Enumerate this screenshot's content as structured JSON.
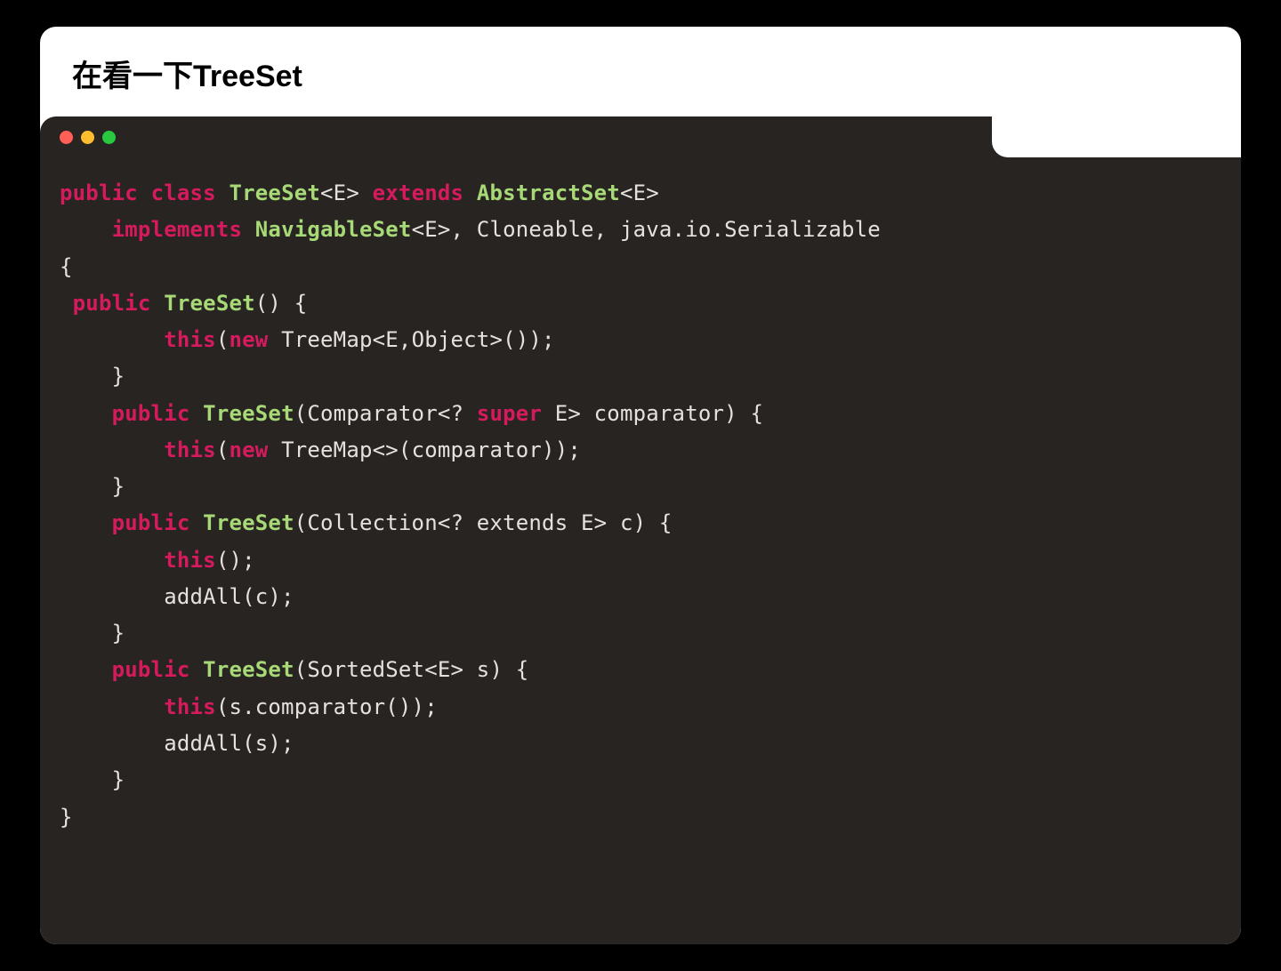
{
  "heading": "在看一下TreeSet",
  "colors": {
    "keyword": "#d61a5e",
    "name": "#a8d977",
    "text": "#e6e1dc",
    "codeBg": "#282422",
    "cardBg": "#ffffff",
    "pageBg": "#000000",
    "dotRed": "#ff5f57",
    "dotYellow": "#febc2e",
    "dotGreen": "#28c840"
  },
  "code": {
    "lines": [
      [
        {
          "cls": "kw-pub",
          "t": "public"
        },
        {
          "cls": "plain",
          "t": " "
        },
        {
          "cls": "kw-cls",
          "t": "class"
        },
        {
          "cls": "plain",
          "t": " "
        },
        {
          "cls": "name",
          "t": "TreeSet"
        },
        {
          "cls": "plain",
          "t": "<E> "
        },
        {
          "cls": "kw-ext",
          "t": "extends"
        },
        {
          "cls": "plain",
          "t": " "
        },
        {
          "cls": "name",
          "t": "AbstractSet"
        },
        {
          "cls": "plain",
          "t": "<E>"
        }
      ],
      [
        {
          "cls": "plain",
          "t": "    "
        },
        {
          "cls": "kw-impl",
          "t": "implements"
        },
        {
          "cls": "plain",
          "t": " "
        },
        {
          "cls": "name",
          "t": "NavigableSet"
        },
        {
          "cls": "plain",
          "t": "<E>, Cloneable, java.io.Serializable"
        }
      ],
      [
        {
          "cls": "plain",
          "t": "{"
        }
      ],
      [
        {
          "cls": "plain",
          "t": " "
        },
        {
          "cls": "kw-pub",
          "t": "public"
        },
        {
          "cls": "plain",
          "t": " "
        },
        {
          "cls": "name",
          "t": "TreeSet"
        },
        {
          "cls": "plain",
          "t": "() {"
        }
      ],
      [
        {
          "cls": "plain",
          "t": "        "
        },
        {
          "cls": "kw-this",
          "t": "this"
        },
        {
          "cls": "plain",
          "t": "("
        },
        {
          "cls": "kw-new",
          "t": "new"
        },
        {
          "cls": "plain",
          "t": " TreeMap<E,Object>());"
        }
      ],
      [
        {
          "cls": "plain",
          "t": "    }"
        }
      ],
      [
        {
          "cls": "plain",
          "t": "    "
        },
        {
          "cls": "kw-pub",
          "t": "public"
        },
        {
          "cls": "plain",
          "t": " "
        },
        {
          "cls": "name",
          "t": "TreeSet"
        },
        {
          "cls": "plain",
          "t": "(Comparator<? "
        },
        {
          "cls": "kw-super",
          "t": "super"
        },
        {
          "cls": "plain",
          "t": " E> comparator) {"
        }
      ],
      [
        {
          "cls": "plain",
          "t": "        "
        },
        {
          "cls": "kw-this",
          "t": "this"
        },
        {
          "cls": "plain",
          "t": "("
        },
        {
          "cls": "kw-new",
          "t": "new"
        },
        {
          "cls": "plain",
          "t": " TreeMap<>(comparator));"
        }
      ],
      [
        {
          "cls": "plain",
          "t": "    }"
        }
      ],
      [
        {
          "cls": "plain",
          "t": "    "
        },
        {
          "cls": "kw-pub",
          "t": "public"
        },
        {
          "cls": "plain",
          "t": " "
        },
        {
          "cls": "name",
          "t": "TreeSet"
        },
        {
          "cls": "plain",
          "t": "(Collection<? extends E> c) {"
        }
      ],
      [
        {
          "cls": "plain",
          "t": "        "
        },
        {
          "cls": "kw-this",
          "t": "this"
        },
        {
          "cls": "plain",
          "t": "();"
        }
      ],
      [
        {
          "cls": "plain",
          "t": "        addAll(c);"
        }
      ],
      [
        {
          "cls": "plain",
          "t": "    }"
        }
      ],
      [
        {
          "cls": "plain",
          "t": "    "
        },
        {
          "cls": "kw-pub",
          "t": "public"
        },
        {
          "cls": "plain",
          "t": " "
        },
        {
          "cls": "name",
          "t": "TreeSet"
        },
        {
          "cls": "plain",
          "t": "(SortedSet<E> s) {"
        }
      ],
      [
        {
          "cls": "plain",
          "t": "        "
        },
        {
          "cls": "kw-this",
          "t": "this"
        },
        {
          "cls": "plain",
          "t": "(s.comparator());"
        }
      ],
      [
        {
          "cls": "plain",
          "t": "        addAll(s);"
        }
      ],
      [
        {
          "cls": "plain",
          "t": "    }"
        }
      ],
      [
        {
          "cls": "plain",
          "t": "}"
        }
      ]
    ]
  }
}
